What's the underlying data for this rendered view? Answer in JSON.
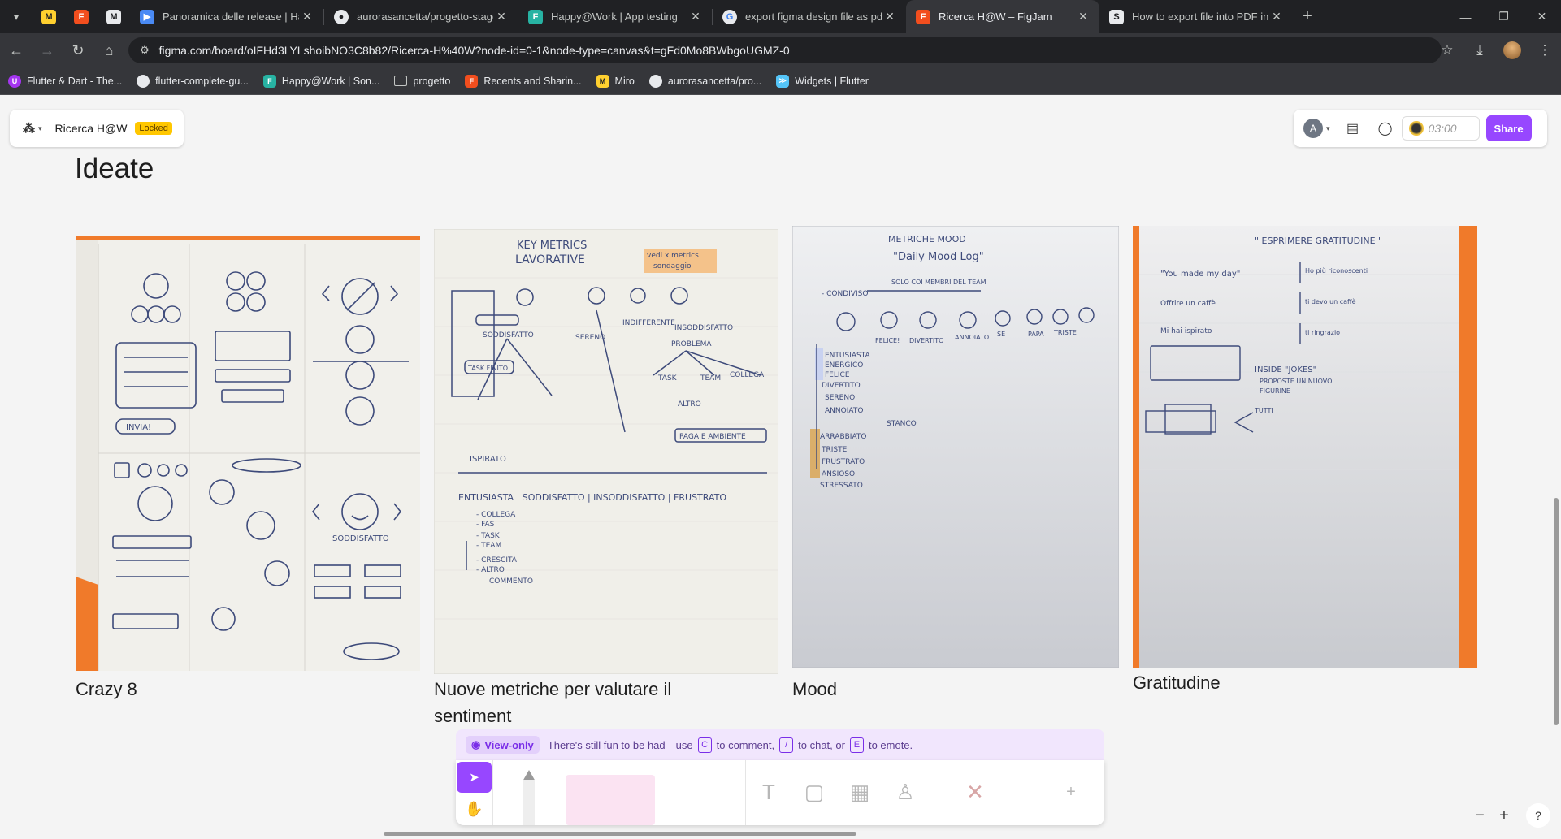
{
  "browser": {
    "pinned_tabs": [
      {
        "icon": "miro-icon",
        "color": "#ffd02f",
        "glyph": "M"
      },
      {
        "icon": "figma-icon",
        "color": "#f24e1e",
        "glyph": "F"
      },
      {
        "icon": "medium-icon",
        "color": "#e8eaed",
        "glyph": "M"
      }
    ],
    "tabs": [
      {
        "title": "Panoramica delle release | Happ",
        "icon": "play-console-icon",
        "color": "#4a8af4",
        "active": false
      },
      {
        "title": "aurorasancetta/progetto-stage",
        "icon": "github-icon",
        "color": "#e8eaed",
        "active": false
      },
      {
        "title": "Happy@Work | App testing",
        "icon": "firebase-icon",
        "color": "#27b3a3",
        "active": false
      },
      {
        "title": "export figma design file as pdf",
        "icon": "google-icon",
        "color": "#e8eaed",
        "active": false
      },
      {
        "title": "Ricerca H@W – FigJam",
        "icon": "figma-icon",
        "color": "#f24e1e",
        "active": true
      },
      {
        "title": "How to export file into PDF in F",
        "icon": "stackexchange-icon",
        "color": "#e8eaed",
        "active": false
      }
    ],
    "url": "figma.com/board/oIFHd3LYLshoibNO3C8b82/Ricerca-H%40W?node-id=0-1&node-type=canvas&t=gFd0Mo8BWbgoUGMZ-0",
    "bookmarks": [
      {
        "label": "Flutter & Dart - The...",
        "icon": "udemy-icon",
        "color": "#a435f0"
      },
      {
        "label": "flutter-complete-gu...",
        "icon": "github-icon",
        "color": "#e8eaed"
      },
      {
        "label": "Happy@Work | Son...",
        "icon": "firebase-icon",
        "color": "#27b3a3"
      },
      {
        "label": "progetto",
        "icon": "folder-icon",
        "color": "#c4c7c5"
      },
      {
        "label": "Recents and Sharin...",
        "icon": "figma-icon",
        "color": "#f24e1e"
      },
      {
        "label": "Miro",
        "icon": "miro-icon",
        "color": "#ffd02f"
      },
      {
        "label": "aurorasancetta/pro...",
        "icon": "github-icon",
        "color": "#e8eaed"
      },
      {
        "label": "Widgets | Flutter",
        "icon": "flutter-icon",
        "color": "#54c5f8"
      }
    ]
  },
  "figjam": {
    "doc_name": "Ricerca H@W",
    "locked_label": "Locked",
    "avatar_letter": "A",
    "timer": "03:00",
    "share_label": "Share",
    "section_title": "Ideate",
    "cards": [
      {
        "caption": "Crazy 8"
      },
      {
        "caption": "Nuove metriche per valutare il sentiment"
      },
      {
        "caption": "Mood"
      },
      {
        "caption": "Gratitudine"
      }
    ],
    "sketch_text": {
      "crazy8": {
        "invia": "INVIA!",
        "soddisfatto": "SODDISFATTO"
      },
      "metrics": {
        "title1": "KEY METRICS",
        "title2": "LAVORATIVE",
        "note1": "vedi x metrics",
        "note2": "sondaggio",
        "soddisfatto": "SODDISFATTO",
        "sereno": "SERENO",
        "indifferente": "INDIFFERENTE",
        "insoddisfatto": "INSODDISFATTO",
        "problema": "PROBLEMA",
        "task_finito": "TASK FINITO",
        "task": "TASK",
        "team": "TEAM",
        "collega": "COLLEGA",
        "altro": "ALTRO",
        "paga": "PAGA E AMBIENTE",
        "ispirato": "ISPIRATO",
        "row_header": "ENTUSIASTA | SODDISFATTO | INSODDISFATTO | FRUSTRATO",
        "list": [
          "- COLLEGA",
          "- FAS",
          "- TASK",
          "- TEAM",
          "- CRESCITA",
          "- ALTRO",
          "COMMENTO"
        ]
      },
      "mood": {
        "title1": "METRICHE MOOD",
        "title2": "\"Daily Mood Log\"",
        "note": "SOLO COI MEMBRI DEL TEAM",
        "condiviso": "- CONDIVISO",
        "faces": [
          "FELICE!",
          "DIVERTITO",
          "ANNOIATO",
          "SE",
          "PAPA",
          "TRISTE"
        ],
        "list": [
          "ENTUSIASTA",
          "ENERGICO",
          "FELICE",
          "DIVERTITO",
          "SERENO",
          "ANNOIATO",
          "ARRABBIATO",
          "TRISTE",
          "FRUSTRATO",
          "ANSIOSO",
          "STRESSATO"
        ],
        "stanco": "STANCO"
      },
      "grat": {
        "title": "\" ESPRIMERE GRATITUDINE \"",
        "l1": "\"You made my day\"",
        "l2": "Offrire un caffè",
        "l3": "Mi hai ispirato",
        "r1": "Ho più riconoscenti",
        "r2": "ti devo un caffè",
        "r3": "ti ringrazio",
        "inside": "INSIDE \"JOKES\"",
        "inside2": "PROPOSTE UN NUOVO",
        "inside3": "FIGURINE",
        "tutti": "TUTTI"
      }
    },
    "viewonly": {
      "badge": "View-only",
      "text_before": "There's still fun to be had—use",
      "key1": "C",
      "text_mid1": "to comment,",
      "key2": "/",
      "text_mid2": "to chat, or",
      "key3": "E",
      "text_end": "to emote."
    },
    "zoom": {
      "minus": "−",
      "plus": "+",
      "help": "?"
    }
  }
}
